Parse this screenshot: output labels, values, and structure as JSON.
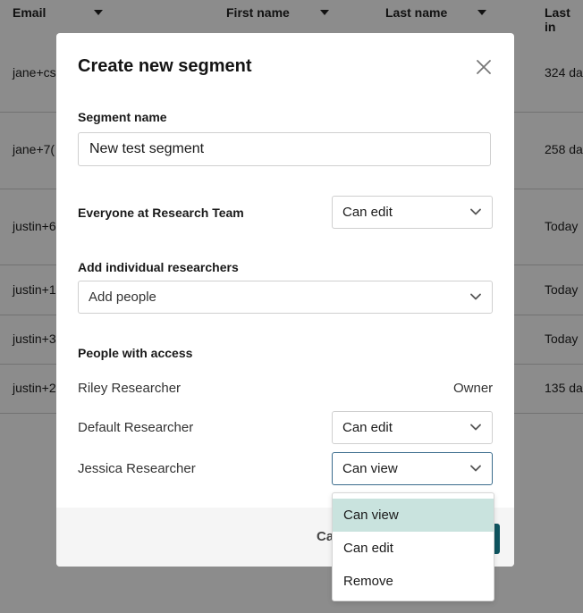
{
  "background_table": {
    "headers": {
      "email": "Email",
      "first_name": "First name",
      "last_name": "Last name",
      "last_interaction": "Last in"
    },
    "rows": [
      {
        "email": "jane+cs",
        "last": "324 da"
      },
      {
        "email": "jane+7(",
        "last": "258 da"
      },
      {
        "email": "justin+6",
        "last": "Today"
      },
      {
        "email": "justin+1",
        "last": "Today"
      },
      {
        "email": "justin+3",
        "last": "Today"
      },
      {
        "email": "justin+2",
        "last": "135 da"
      }
    ]
  },
  "modal": {
    "title": "Create new segment",
    "segment_name_label": "Segment name",
    "segment_name_value": "New test segment",
    "everyone_label": "Everyone at Research Team",
    "everyone_permission": "Can edit",
    "add_individuals_label": "Add individual researchers",
    "add_people_placeholder": "Add people",
    "people_with_access_label": "People with access",
    "people": [
      {
        "name": "Riley Researcher",
        "role": "Owner"
      },
      {
        "name": "Default Researcher",
        "role": "Can edit"
      },
      {
        "name": "Jessica Researcher",
        "role": "Can view"
      }
    ],
    "footer": {
      "cancel_label_partial": "Ca"
    }
  },
  "dropdown": {
    "options": [
      "Can view",
      "Can edit",
      "Remove"
    ],
    "selected": "Can view"
  },
  "colors": {
    "accent": "#0f5560",
    "option_highlight": "#c9e3de",
    "focus_border": "#3a6b8c"
  }
}
